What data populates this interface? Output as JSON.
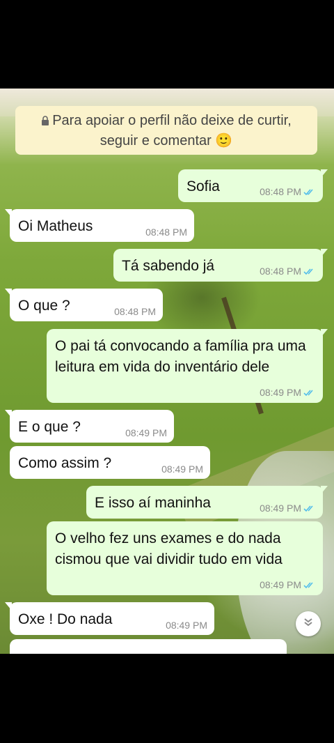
{
  "notice": {
    "text": "Para apoiar o perfil não deixe de curtir, seguir e comentar 🙂"
  },
  "messages": [
    {
      "dir": "out",
      "text": "Sofia",
      "time": "08:48 PM"
    },
    {
      "dir": "in",
      "text": "Oi Matheus",
      "time": "08:48 PM"
    },
    {
      "dir": "out",
      "text": "Tá sabendo já",
      "time": "08:48 PM"
    },
    {
      "dir": "in",
      "text": "O que ?",
      "time": "08:48 PM"
    },
    {
      "dir": "out",
      "text": "O pai tá convocando a família pra uma leitura em vida do inventário dele",
      "time": "08:49 PM"
    },
    {
      "dir": "in",
      "text": "E o que ?",
      "time": "08:49 PM"
    },
    {
      "dir": "in",
      "text": "Como assim ?",
      "time": "08:49 PM"
    },
    {
      "dir": "out",
      "text": "E isso aí maninha",
      "time": "08:49 PM"
    },
    {
      "dir": "out",
      "text": "O velho fez uns exames e do nada cismou que vai dividir tudo em vida",
      "time": "08:49 PM"
    },
    {
      "dir": "in",
      "text": "Oxe ! Do nada",
      "time": "08:49 PM"
    }
  ],
  "colors": {
    "outgoing": "#e7ffdb",
    "incoming": "#ffffff",
    "ticks": "#53bdeb",
    "notice": "#fbf3cc"
  },
  "icons": {
    "notice": "lock-icon",
    "read": "double-check-icon",
    "scroll": "chevron-double-down-icon"
  }
}
